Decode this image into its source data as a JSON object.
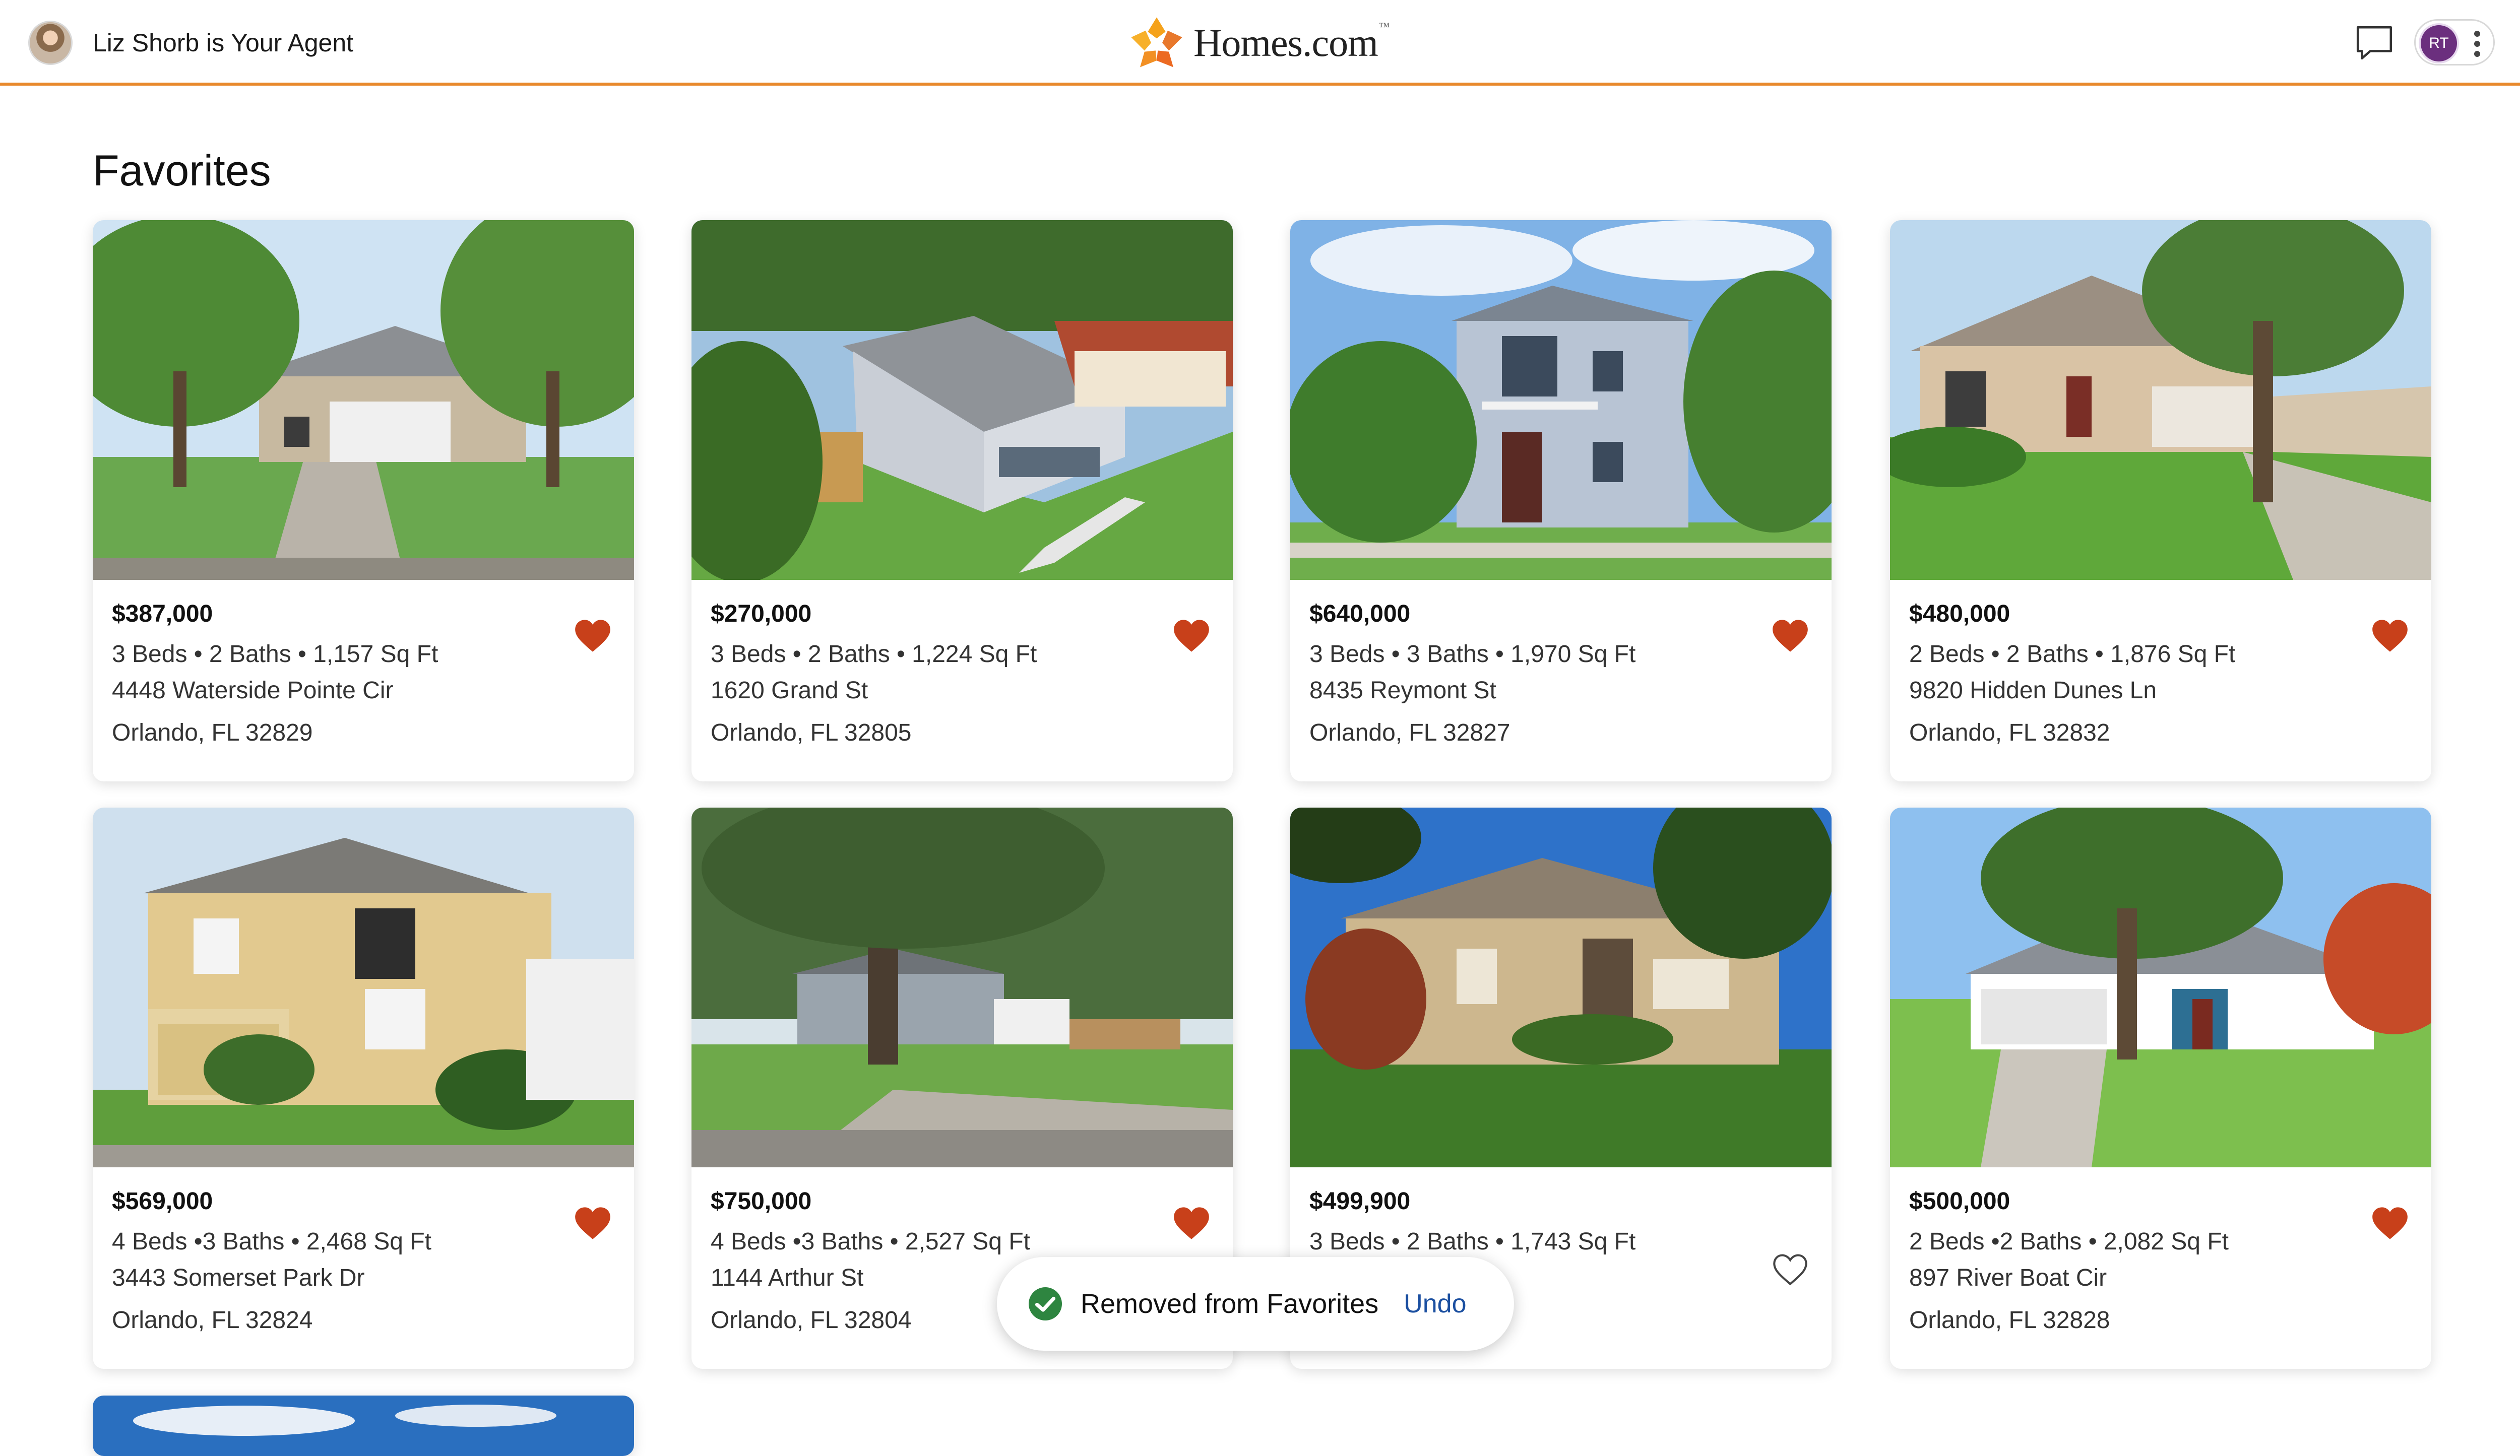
{
  "header": {
    "agent_text": "Liz Shorb is Your Agent",
    "logo_text": "Homes.com",
    "logo_trademark": "™",
    "user_initials": "RT"
  },
  "page": {
    "title": "Favorites"
  },
  "colors": {
    "accent": "#e8892c",
    "heart": "#c8401a",
    "toast_check": "#2e8540",
    "undo": "#1b4fa0"
  },
  "listings": [
    {
      "price": "$387,000",
      "specs": "3 Beds • 2 Baths • 1,157 Sq Ft",
      "street": "4448 Waterside Pointe Cir",
      "city": "Orlando, FL 32829",
      "favorited": true
    },
    {
      "price": "$270,000",
      "specs": "3 Beds • 2 Baths • 1,224 Sq Ft",
      "street": "1620 Grand St",
      "city": "Orlando, FL 32805",
      "favorited": true
    },
    {
      "price": "$640,000",
      "specs": "3 Beds • 3 Baths • 1,970 Sq Ft",
      "street": "8435 Reymont St",
      "city": "Orlando, FL 32827",
      "favorited": true
    },
    {
      "price": "$480,000",
      "specs": "2 Beds • 2 Baths • 1,876 Sq Ft",
      "street": "9820 Hidden Dunes Ln",
      "city": "Orlando, FL 32832",
      "favorited": true
    },
    {
      "price": "$569,000",
      "specs": "4 Beds •3 Baths • 2,468 Sq Ft",
      "street": "3443 Somerset Park Dr",
      "city": "Orlando, FL 32824",
      "favorited": true
    },
    {
      "price": "$750,000",
      "specs": "4 Beds •3 Baths • 2,527 Sq Ft",
      "street": "1144 Arthur St",
      "city": "Orlando, FL 32804",
      "favorited": true
    },
    {
      "price": "$499,900",
      "specs": "3 Beds • 2 Baths • 1,743 Sq Ft",
      "street": "",
      "city": "",
      "favorited": false
    },
    {
      "price": "$500,000",
      "specs": "2 Beds •2 Baths • 2,082 Sq Ft",
      "street": "897 River Boat Cir",
      "city": "Orlando, FL 32828",
      "favorited": true
    }
  ],
  "toast": {
    "message": "Removed from Favorites",
    "action": "Undo"
  }
}
